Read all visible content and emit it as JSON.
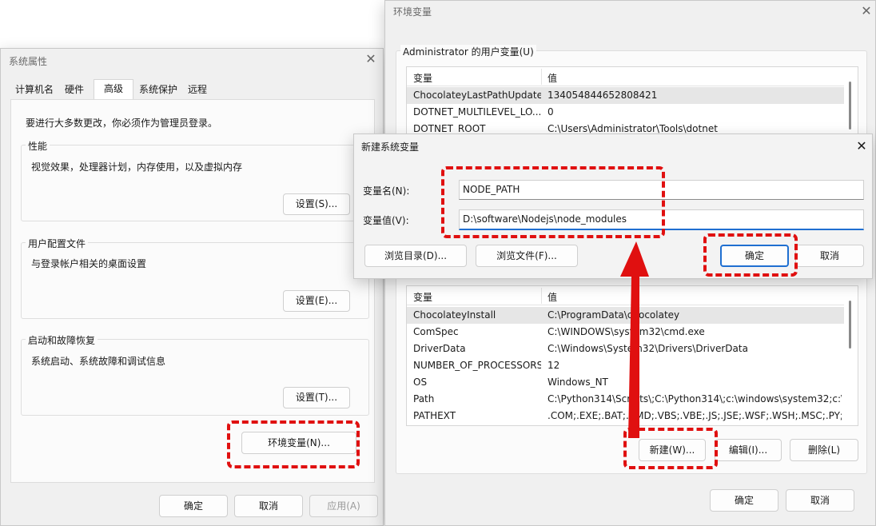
{
  "sys_props": {
    "title": "系统属性",
    "tabs": [
      "计算机名",
      "硬件",
      "高级",
      "系统保护",
      "远程"
    ],
    "admin_notice": "要进行大多数更改，你必须作为管理员登录。",
    "performance": {
      "label": "性能",
      "desc": "视觉效果，处理器计划，内存使用，以及虚拟内存",
      "button": "设置(S)..."
    },
    "user_profiles": {
      "label": "用户配置文件",
      "desc": "与登录帐户相关的桌面设置",
      "button": "设置(E)..."
    },
    "startup": {
      "label": "启动和故障恢复",
      "desc": "系统启动、系统故障和调试信息",
      "button": "设置(T)..."
    },
    "env_button": "环境变量(N)...",
    "ok": "确定",
    "cancel": "取消",
    "apply": "应用(A)"
  },
  "env_vars": {
    "title": "环境变量",
    "user_group_label": "Administrator 的用户变量(U)",
    "columns": [
      "变量",
      "值"
    ],
    "user_vars": [
      {
        "name": "ChocolateyLastPathUpdate",
        "value": "134054844652808421"
      },
      {
        "name": "DOTNET_MULTILEVEL_LO...",
        "value": "0"
      },
      {
        "name": "DOTNET_ROOT",
        "value": "C:\\Users\\Administrator\\Tools\\dotnet"
      }
    ],
    "system_vars": [
      {
        "name": "ChocolateyInstall",
        "value": "C:\\ProgramData\\chocolatey"
      },
      {
        "name": "ComSpec",
        "value": "C:\\WINDOWS\\system32\\cmd.exe"
      },
      {
        "name": "DriverData",
        "value": "C:\\Windows\\System32\\Drivers\\DriverData"
      },
      {
        "name": "NUMBER_OF_PROCESSORS",
        "value": "12"
      },
      {
        "name": "OS",
        "value": "Windows_NT"
      },
      {
        "name": "Path",
        "value": "C:\\Python314\\Scripts\\;C:\\Python314\\;c:\\windows\\system32;c:\\..."
      },
      {
        "name": "PATHEXT",
        "value": ".COM;.EXE;.BAT;.CMD;.VBS;.VBE;.JS;.JSE;.WSF;.WSH;.MSC;.PY;.P..."
      }
    ],
    "new_button": "新建(W)...",
    "edit_button": "编辑(I)...",
    "delete_button": "删除(L)",
    "ok": "确定",
    "cancel": "取消"
  },
  "new_var_dialog": {
    "title": "新建系统变量",
    "name_label": "变量名(N):",
    "name_value": "NODE_PATH",
    "value_label": "变量值(V):",
    "value_value": "D:\\software\\Nodejs\\node_modules",
    "browse_dir": "浏览目录(D)...",
    "browse_file": "浏览文件(F)...",
    "ok": "确定",
    "cancel": "取消"
  },
  "colors": {
    "annotation": "#e01010",
    "accent": "#1f6fd1",
    "row_highlight": "#e6e6e6"
  }
}
